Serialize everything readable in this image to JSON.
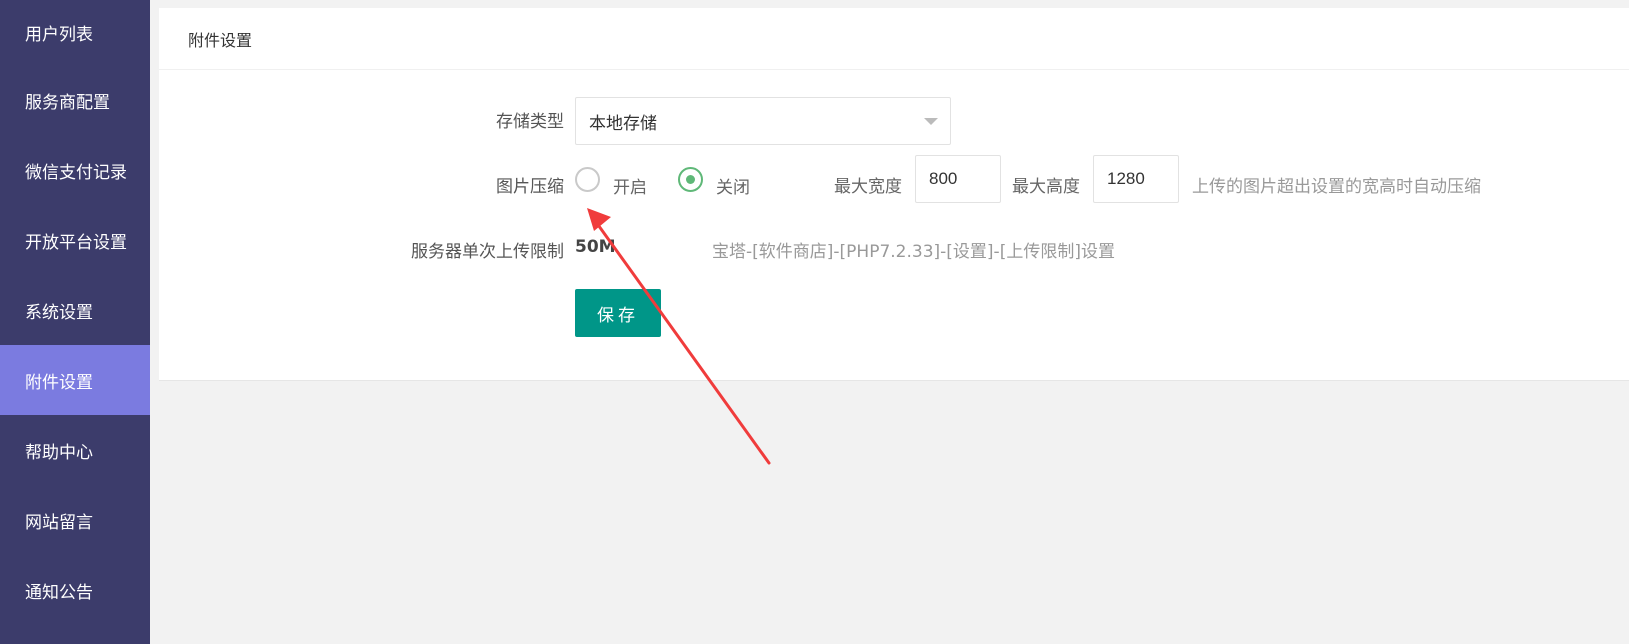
{
  "sidebar": {
    "items": [
      {
        "label": "用户列表"
      },
      {
        "label": "服务商配置"
      },
      {
        "label": "微信支付记录"
      },
      {
        "label": "开放平台设置"
      },
      {
        "label": "系统设置"
      },
      {
        "label": "附件设置",
        "active": true
      },
      {
        "label": "帮助中心"
      },
      {
        "label": "网站留言"
      },
      {
        "label": "通知公告"
      }
    ]
  },
  "panel": {
    "title": "附件设置",
    "storage": {
      "label": "存储类型",
      "selected": "本地存储"
    },
    "compress": {
      "label": "图片压缩",
      "options": [
        {
          "label": "开启",
          "checked": false
        },
        {
          "label": "关闭",
          "checked": true
        }
      ],
      "max_width_label": "最大宽度",
      "max_width_value": "800",
      "max_height_label": "最大高度",
      "max_height_value": "1280",
      "hint": "上传的图片超出设置的宽高时自动压缩"
    },
    "upload_limit": {
      "label": "服务器单次上传限制",
      "value": "50M",
      "hint": "宝塔-[软件商店]-[PHP7.2.33]-[设置]-[上传限制]设置"
    },
    "save_label": "保存"
  },
  "colors": {
    "sidebar_bg": "#3c3c6b",
    "sidebar_active": "#7b7be0",
    "primary_button": "#009688",
    "radio_checked": "#5fb878",
    "annotation_arrow": "#f03c3c"
  }
}
